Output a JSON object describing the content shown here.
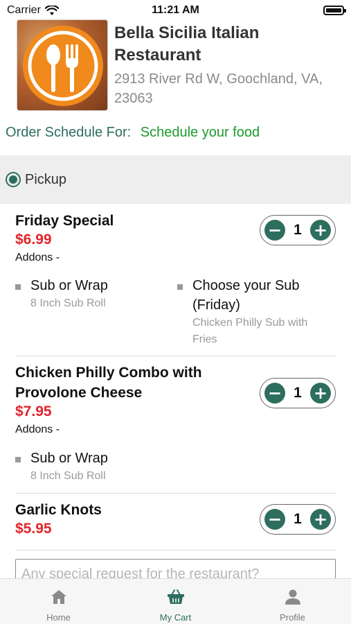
{
  "status_bar": {
    "carrier": "Carrier",
    "time": "11:21 AM"
  },
  "restaurant": {
    "name": "Bella Sicilia Italian Restaurant",
    "address": "2913 River Rd W, Goochland, VA, 23063"
  },
  "schedule": {
    "label": "Order Schedule For:",
    "value": "Schedule your food"
  },
  "order_type": {
    "label": "Pickup",
    "selected": true
  },
  "items": [
    {
      "name": "Friday Special",
      "price": "$6.99",
      "addons_label": "Addons -",
      "quantity": "1",
      "addons": [
        {
          "name": "Sub or Wrap",
          "detail": "8 Inch Sub Roll"
        },
        {
          "name": "Choose your Sub (Friday)",
          "detail": "Chicken Philly Sub with Fries"
        }
      ]
    },
    {
      "name": "Chicken Philly Combo with Provolone Cheese",
      "price": "$7.95",
      "addons_label": "Addons -",
      "quantity": "1",
      "addons": [
        {
          "name": "Sub or Wrap",
          "detail": "8 Inch Sub Roll"
        }
      ]
    },
    {
      "name": "Garlic Knots",
      "price": "$5.95",
      "quantity": "1"
    }
  ],
  "special_request": {
    "placeholder": "Any special request for the restaurant?"
  },
  "tab_bar": {
    "tabs": [
      {
        "label": "Home",
        "icon": "home-icon"
      },
      {
        "label": "My Cart",
        "icon": "basket-icon",
        "active": true
      },
      {
        "label": "Profile",
        "icon": "person-icon"
      }
    ]
  },
  "colors": {
    "accent": "#2d6e5e",
    "price": "#e3242b",
    "schedule_value": "#1b9a2c",
    "logo_orange": "#f08a1c"
  }
}
